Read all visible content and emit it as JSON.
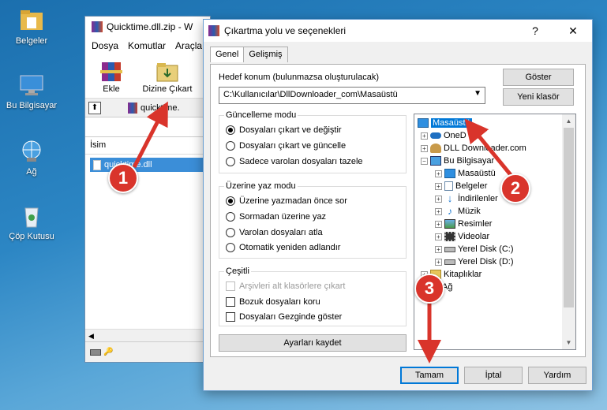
{
  "desktop": {
    "icons": [
      {
        "label": "Belgeler",
        "icon": "folder-documents-icon"
      },
      {
        "label": "Bu Bilgisayar",
        "icon": "computer-icon"
      },
      {
        "label": "Ağ",
        "icon": "network-icon"
      },
      {
        "label": "Çöp Kutusu",
        "icon": "recycle-bin-icon"
      }
    ]
  },
  "winrar": {
    "title": "Quicktime.dll.zip - W",
    "menu": [
      "Dosya",
      "Komutlar",
      "Araçla"
    ],
    "toolbar": {
      "add_label": "Ekle",
      "extract_label": "Dizine Çıkart"
    },
    "address": "quicktime.",
    "column_name": "İsim",
    "file_name": "quicktime.dll"
  },
  "dialog": {
    "title": "Çıkartma yolu ve seçenekleri",
    "help_glyph": "?",
    "close_glyph": "✕",
    "tabs": [
      "Genel",
      "Gelişmiş"
    ],
    "destination_label": "Hedef konum (bulunmazsa oluşturulacak)",
    "destination_value": "C:\\Kullanıcılar\\DllDownloader_com\\Masaüstü",
    "show_button": "Göster",
    "new_folder_button": "Yeni klasör",
    "update_mode": {
      "title": "Güncelleme modu",
      "options": [
        "Dosyaları çıkart ve değiştir",
        "Dosyaları çıkart ve güncelle",
        "Sadece varolan dosyaları tazele"
      ],
      "selected": 0
    },
    "overwrite_mode": {
      "title": "Üzerine yaz modu",
      "options": [
        "Üzerine yazmadan önce sor",
        "Sormadan üzerine yaz",
        "Varolan dosyaları atla",
        "Otomatik yeniden adlandır"
      ],
      "selected": 0
    },
    "misc": {
      "title": "Çeşitli",
      "options": [
        {
          "label": "Arşivleri alt klasörlere çıkart",
          "checked": false,
          "disabled": true
        },
        {
          "label": "Bozuk dosyaları koru",
          "checked": false,
          "disabled": false
        },
        {
          "label": "Dosyaları Gezginde göster",
          "checked": false,
          "disabled": false
        }
      ]
    },
    "save_settings_button": "Ayarları kaydet",
    "tree": [
      {
        "label": "Masaüstü",
        "icon": "desktop-icon",
        "selected": true,
        "expander": ""
      },
      {
        "label": "OneD",
        "icon": "onedrive-icon",
        "expander": "+"
      },
      {
        "label": "DLL Downloader.com",
        "icon": "user-folder-icon",
        "expander": "+"
      },
      {
        "label": "Bu Bilgisayar",
        "icon": "computer-icon",
        "expander": "−"
      },
      {
        "label": "Masaüstü",
        "icon": "desktop-icon",
        "expander": "+"
      },
      {
        "label": "Belgeler",
        "icon": "documents-icon",
        "expander": "+"
      },
      {
        "label": "İndirilenler",
        "icon": "downloads-icon",
        "expander": "+"
      },
      {
        "label": "Müzik",
        "icon": "music-icon",
        "expander": "+"
      },
      {
        "label": "Resimler",
        "icon": "pictures-icon",
        "expander": "+"
      },
      {
        "label": "Videolar",
        "icon": "videos-icon",
        "expander": "+"
      },
      {
        "label": "Yerel Disk (C:)",
        "icon": "disk-icon",
        "expander": "+"
      },
      {
        "label": "Yerel Disk (D:)",
        "icon": "disk-icon",
        "expander": "+"
      },
      {
        "label": "Kitaplıklar",
        "icon": "libraries-icon",
        "expander": "+"
      },
      {
        "label": "Ağ",
        "icon": "network-icon",
        "expander": "+"
      }
    ],
    "ok_button": "Tamam",
    "cancel_button": "İptal",
    "help_button": "Yardım"
  },
  "annotations": {
    "steps": [
      "1",
      "2",
      "3"
    ],
    "color": "#d9342b"
  }
}
